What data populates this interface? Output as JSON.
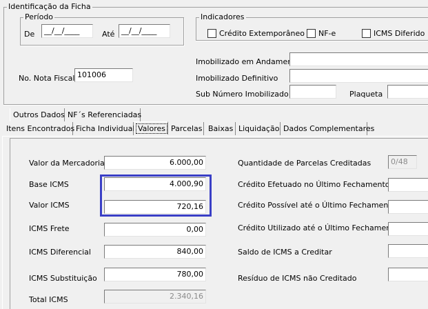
{
  "identificacao": {
    "title": "Identificação da Ficha",
    "periodo": {
      "title": "Período",
      "de_label": "De",
      "de_value": "__/__/____",
      "ate_label": "Até",
      "ate_value": "__/__/____"
    },
    "indicadores": {
      "title": "Indicadores",
      "items": [
        {
          "label": "Crédito Extemporâneo",
          "checked": false
        },
        {
          "label": "NF-e",
          "checked": false
        },
        {
          "label": "ICMS Diferido",
          "checked": false
        }
      ]
    },
    "nota_fiscal_label": "No. Nota Fiscal",
    "nota_fiscal_value": "101006",
    "imob_andamento_label": "Imobilizado em Andamento",
    "imob_andamento_value": "",
    "imob_definitivo_label": "Imobilizado Definitivo",
    "imob_definitivo_value": "",
    "sub_numero_label": "Sub Número Imobilizado",
    "sub_numero_value": "",
    "plaqueta_label": "Plaqueta",
    "plaqueta_value": ""
  },
  "tabs_row1": [
    "Outros Dados",
    "NF´s Referenciadas"
  ],
  "tabs_row2": [
    "Itens Encontrados",
    "Ficha Individual",
    "Valores",
    "Parcelas",
    "Baixas",
    "Liquidação",
    "Dados Complementares"
  ],
  "active_tab": "Valores",
  "highlight_color": "#3a3fc6",
  "valores": {
    "left": [
      {
        "label": "Valor da Mercadoria",
        "value": "6.000,00"
      },
      {
        "label": "Base ICMS",
        "value": "4.000,90"
      },
      {
        "label": "Valor ICMS",
        "value": "720,16"
      },
      {
        "label": "ICMS Frete",
        "value": "0,00"
      },
      {
        "label": "ICMS Diferencial",
        "value": "840,00"
      },
      {
        "label": "ICMS Substituição",
        "value": "780,00"
      },
      {
        "label": "Total ICMS",
        "value": "2.340,16"
      }
    ],
    "right": [
      {
        "label": "Quantidade de Parcelas Creditadas",
        "value": "0/48"
      },
      {
        "label": "Crédito Efetuado no Último Fechamento",
        "value": ""
      },
      {
        "label": "Crédito Possível até o Último Fechamento",
        "value": ""
      },
      {
        "label": "Crédito Utilizado até o Último Fechamento",
        "value": ""
      },
      {
        "label": "Saldo de ICMS a Creditar",
        "value": ""
      },
      {
        "label": "Resíduo de ICMS não Creditado",
        "value": ""
      }
    ]
  }
}
